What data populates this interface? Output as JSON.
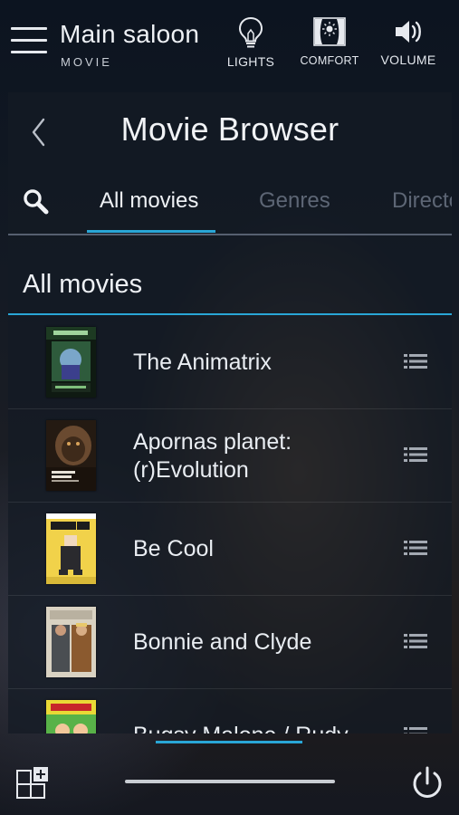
{
  "header": {
    "room_title": "Main saloon",
    "room_subtitle": "MOVIE",
    "quick_actions": [
      {
        "label": "LIGHTS",
        "icon": "lightbulb-icon"
      },
      {
        "label": "COMFORT",
        "icon": "comfort-icon"
      },
      {
        "label": "VOLUME",
        "icon": "speaker-icon"
      }
    ]
  },
  "browser": {
    "title": "Movie Browser",
    "tabs": [
      {
        "label": "All movies",
        "active": true
      },
      {
        "label": "Genres",
        "active": false
      },
      {
        "label": "Directors",
        "active": false
      }
    ],
    "section_title": "All movies",
    "movies": [
      {
        "title": "The Animatrix"
      },
      {
        "title": "Apornas planet: (r)Evolution"
      },
      {
        "title": "Be Cool"
      },
      {
        "title": "Bonnie and Clyde"
      },
      {
        "title": "Bugsy Malone / Rudy"
      }
    ]
  },
  "colors": {
    "accent": "#29a6d6",
    "inactive_tab": "#5d6675"
  }
}
